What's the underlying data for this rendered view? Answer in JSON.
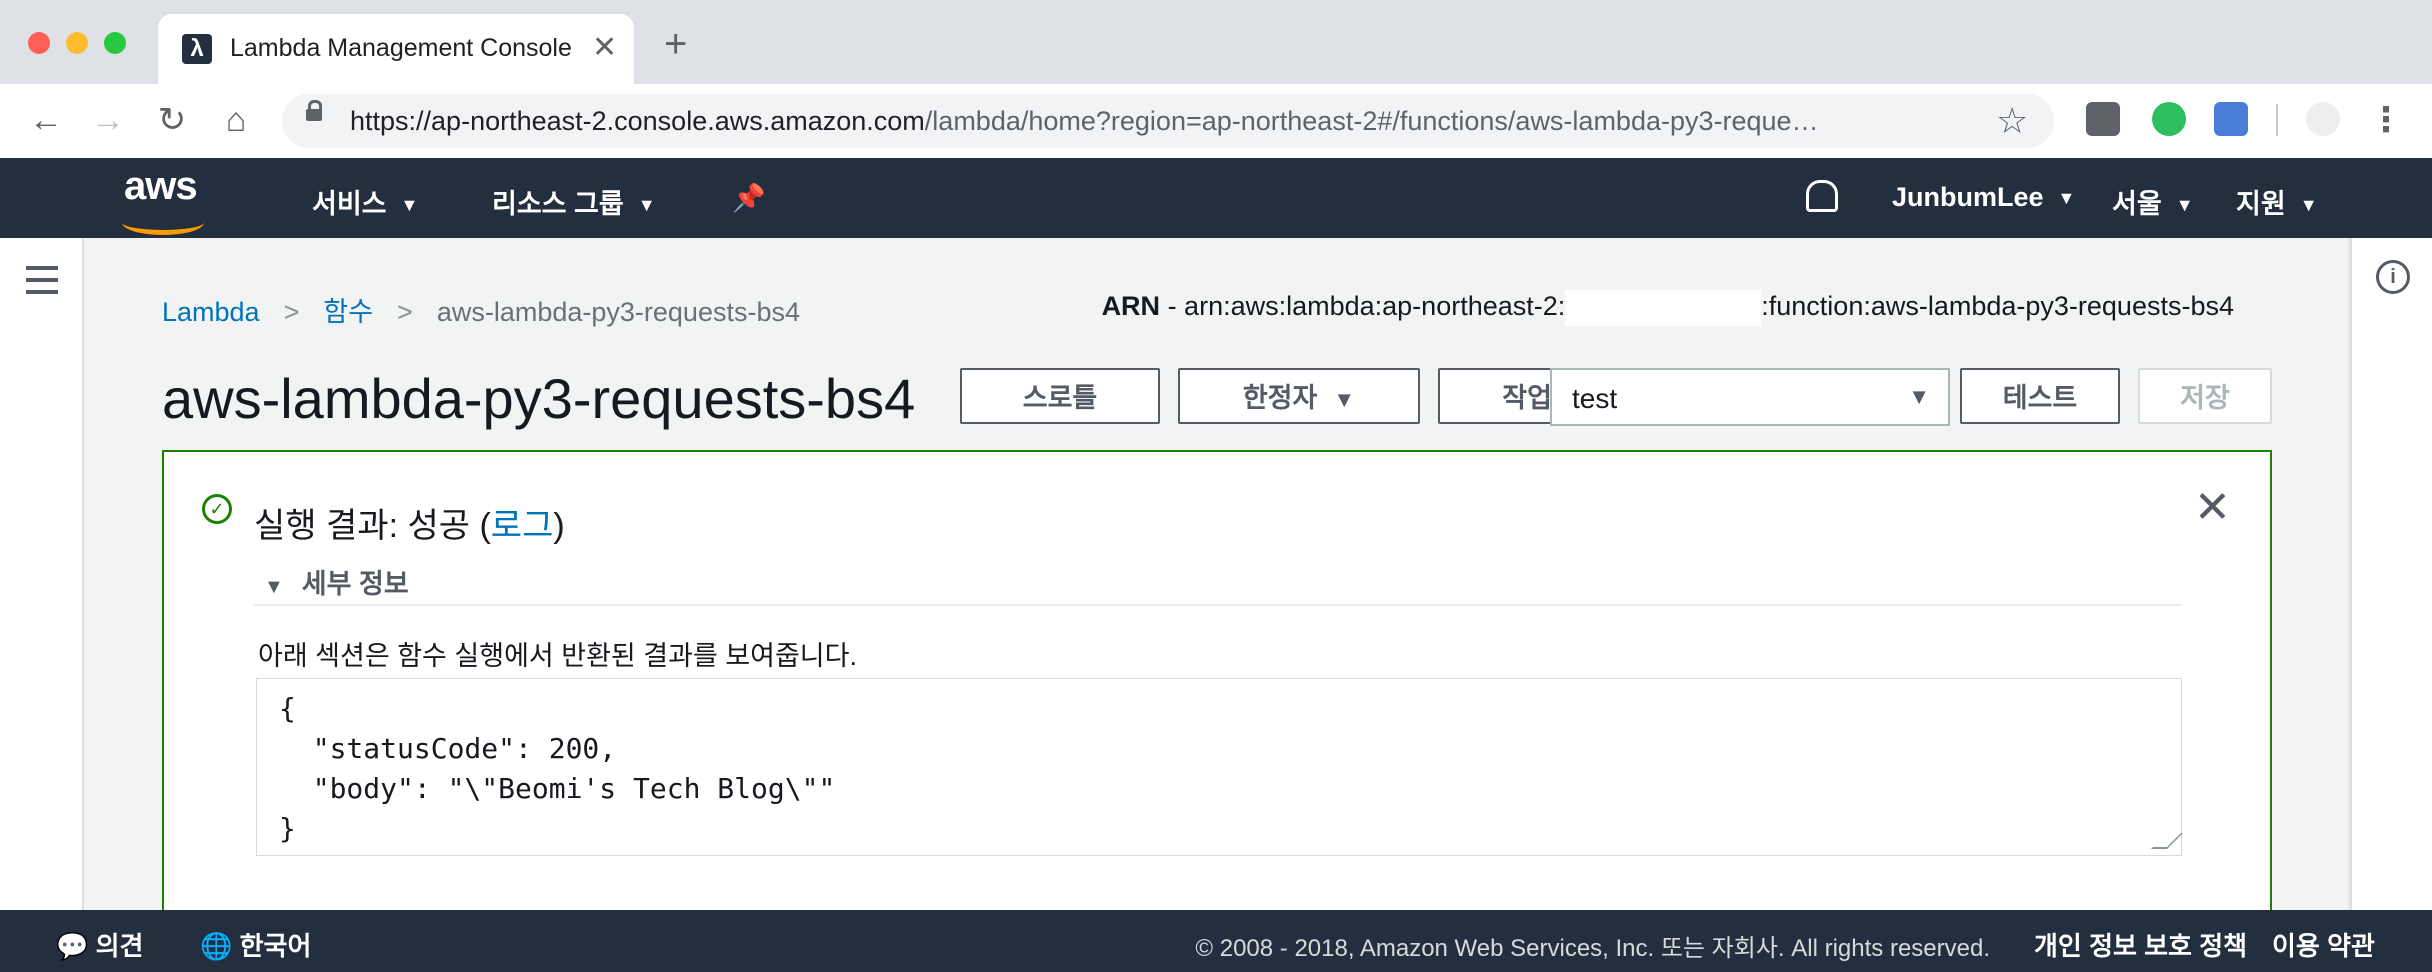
{
  "browser": {
    "tab_title": "Lambda Management Console",
    "url_host": "https://ap-northeast-2.console.aws.amazon.com",
    "url_path": "/lambda/home?region=ap-northeast-2#/functions/aws-lambda-py3-reque…"
  },
  "header": {
    "logo": "aws",
    "services": "서비스",
    "resource_groups": "리소스 그룹",
    "user": "JunbumLee",
    "region": "서울",
    "support": "지원"
  },
  "breadcrumb": {
    "root": "Lambda",
    "functions": "함수",
    "current": "aws-lambda-py3-requests-bs4"
  },
  "arn": {
    "label": "ARN",
    "prefix": " - arn:aws:lambda:ap-northeast-2:",
    "suffix": ":function:aws-lambda-py3-requests-bs4"
  },
  "function": {
    "title": "aws-lambda-py3-requests-bs4",
    "throttle": "스로틀",
    "qualifier": "한정자",
    "actions": "작업",
    "test_event": "test",
    "test": "테스트",
    "save": "저장"
  },
  "result": {
    "prefix": "실행 결과: 성공 (",
    "log_link": "로그",
    "suffix": ")",
    "details_label": "세부 정보",
    "description": "아래 섹션은 함수 실행에서 반환된 결과를 보여줍니다.",
    "output": "{\n  \"statusCode\": 200,\n  \"body\": \"\\\"Beomi's Tech Blog\\\"\"\n}"
  },
  "footer": {
    "feedback": "의견",
    "language": "한국어",
    "copyright": "© 2008 - 2018, Amazon Web Services, Inc. 또는 자회사. All rights reserved.",
    "privacy": "개인 정보 보호 정책",
    "terms": "이용 약관"
  },
  "colors": {
    "aws_nav": "#232f3e",
    "aws_orange": "#ff9900",
    "link_blue": "#0073bb",
    "success_green": "#1d8102"
  }
}
